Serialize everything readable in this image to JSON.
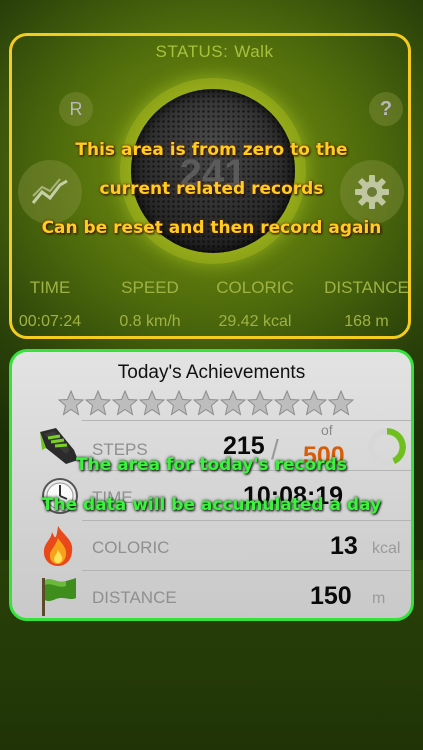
{
  "status": {
    "label": "STATUS:",
    "value": "Walk"
  },
  "dial": {
    "value": "241"
  },
  "buttons": {
    "reset_label": "R",
    "help_label": "?"
  },
  "stats": {
    "labels": [
      "TIME",
      "SPEED",
      "COLORIC",
      "DISTANCE"
    ],
    "values": [
      "00:07:24",
      "0.8 km/h",
      "29.42 kcal",
      "168 m"
    ]
  },
  "annotations": {
    "top_lines": [
      "This area is from zero to the",
      "current related records",
      "Can be reset and then record again"
    ],
    "bottom_lines": [
      "The area for today's records",
      "The data will be accumulated a day"
    ]
  },
  "achievements": {
    "title": "Today's Achievements",
    "star_count": 11,
    "rows": [
      {
        "label": "STEPS",
        "value": "215",
        "goal_prefix": "of",
        "goal": "500",
        "progress": 0.43
      },
      {
        "label": "TIME",
        "value": "10:08:19"
      },
      {
        "label": "COLORIC",
        "value": "13",
        "unit": "kcal"
      },
      {
        "label": "DISTANCE",
        "value": "150",
        "unit": "m"
      }
    ]
  },
  "colors": {
    "status_accent": "#a6c23a",
    "top_frame": "#f5cc1e",
    "bottom_frame": "#35e23a",
    "goal": "#d75d0a"
  }
}
